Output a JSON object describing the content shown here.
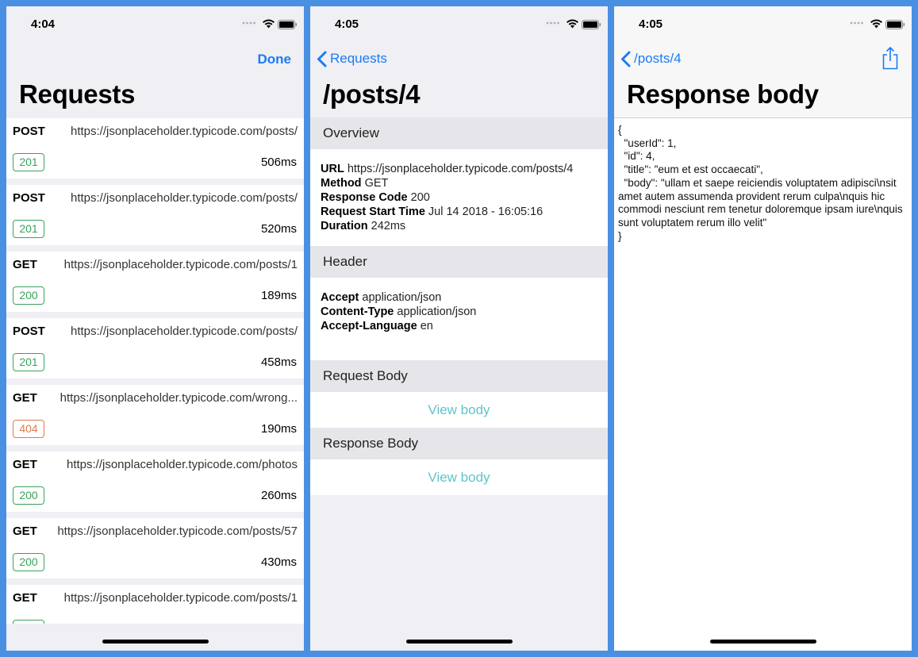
{
  "colors": {
    "accent": "#1a7cf4",
    "success": "#39a35a",
    "error": "#e07a4f",
    "link_teal": "#5ec5c8",
    "frame": "#4a90e2"
  },
  "screen1": {
    "time": "4:04",
    "done_label": "Done",
    "title": "Requests",
    "requests": [
      {
        "method": "POST",
        "url": "https://jsonplaceholder.typicode.com/posts/",
        "status": "201",
        "duration": "506ms",
        "status_kind": "success"
      },
      {
        "method": "POST",
        "url": "https://jsonplaceholder.typicode.com/posts/",
        "status": "201",
        "duration": "520ms",
        "status_kind": "success"
      },
      {
        "method": "GET",
        "url": "https://jsonplaceholder.typicode.com/posts/1",
        "status": "200",
        "duration": "189ms",
        "status_kind": "success"
      },
      {
        "method": "POST",
        "url": "https://jsonplaceholder.typicode.com/posts/",
        "status": "201",
        "duration": "458ms",
        "status_kind": "success"
      },
      {
        "method": "GET",
        "url": "https://jsonplaceholder.typicode.com/wrong...",
        "status": "404",
        "duration": "190ms",
        "status_kind": "error"
      },
      {
        "method": "GET",
        "url": "https://jsonplaceholder.typicode.com/photos",
        "status": "200",
        "duration": "260ms",
        "status_kind": "success"
      },
      {
        "method": "GET",
        "url": "https://jsonplaceholder.typicode.com/posts/57",
        "status": "200",
        "duration": "430ms",
        "status_kind": "success"
      },
      {
        "method": "GET",
        "url": "https://jsonplaceholder.typicode.com/posts/1",
        "status": "",
        "duration": "",
        "status_kind": "success"
      }
    ]
  },
  "screen2": {
    "time": "4:05",
    "back_label": "Requests",
    "title": "/posts/4",
    "overview_header": "Overview",
    "overview": [
      {
        "key": "URL",
        "value": "https://jsonplaceholder.typicode.com/posts/4"
      },
      {
        "key": "Method",
        "value": "GET"
      },
      {
        "key": "Response Code",
        "value": "200"
      },
      {
        "key": "Request Start Time",
        "value": "Jul 14 2018 - 16:05:16"
      },
      {
        "key": "Duration",
        "value": "242ms"
      }
    ],
    "header_header": "Header",
    "headers": [
      {
        "key": "Accept",
        "value": "application/json"
      },
      {
        "key": "Content-Type",
        "value": "application/json"
      },
      {
        "key": "Accept-Language",
        "value": "en"
      }
    ],
    "request_body_header": "Request Body",
    "response_body_header": "Response Body",
    "view_body_label": "View body"
  },
  "screen3": {
    "time": "4:05",
    "back_label": "/posts/4",
    "title": "Response body",
    "body_text": "{\n  \"userId\": 1,\n  \"id\": 4,\n  \"title\": \"eum et est occaecati\",\n  \"body\": \"ullam et saepe reiciendis voluptatem adipisci\\nsit amet autem assumenda provident rerum culpa\\nquis hic commodi nesciunt rem tenetur doloremque ipsam iure\\nquis sunt voluptatem rerum illo velit\"\n}"
  }
}
